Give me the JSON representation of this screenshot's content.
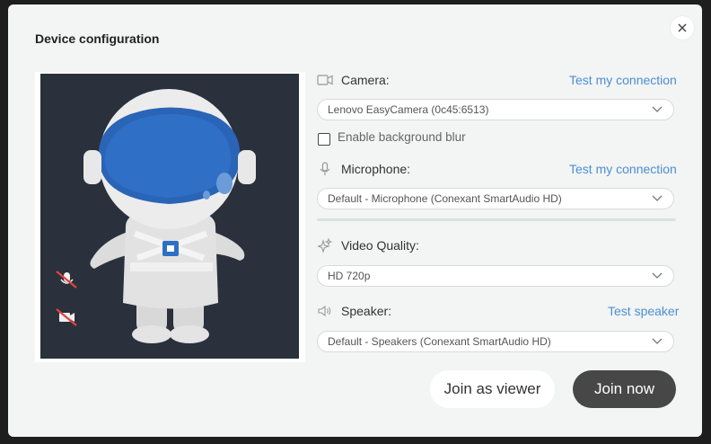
{
  "dialog": {
    "title": "Device configuration"
  },
  "camera": {
    "label": "Camera:",
    "test_link": "Test my connection",
    "selected": "Lenovo EasyCamera (0c45:6513)",
    "blur_label": "Enable background blur",
    "blur_checked": false
  },
  "microphone": {
    "label": "Microphone:",
    "test_link": "Test my connection",
    "selected": "Default - Microphone (Conexant SmartAudio HD)"
  },
  "video_quality": {
    "label": "Video Quality:",
    "selected": "HD 720p"
  },
  "speaker": {
    "label": "Speaker:",
    "test_link": "Test speaker",
    "selected": "Default - Speakers (Conexant SmartAudio HD)"
  },
  "actions": {
    "viewer_label": "Join as viewer",
    "join_label": "Join now"
  },
  "colors": {
    "link": "#4b8fd4",
    "join_button": "#474747",
    "preview_bg": "#2a313c",
    "mute_icon": "#e0443c"
  },
  "icons": [
    "close-icon",
    "camera-icon",
    "microphone-icon",
    "sparkle-icon",
    "speaker-icon",
    "chevron-down-icon",
    "mic-muted-icon",
    "camera-off-icon"
  ]
}
